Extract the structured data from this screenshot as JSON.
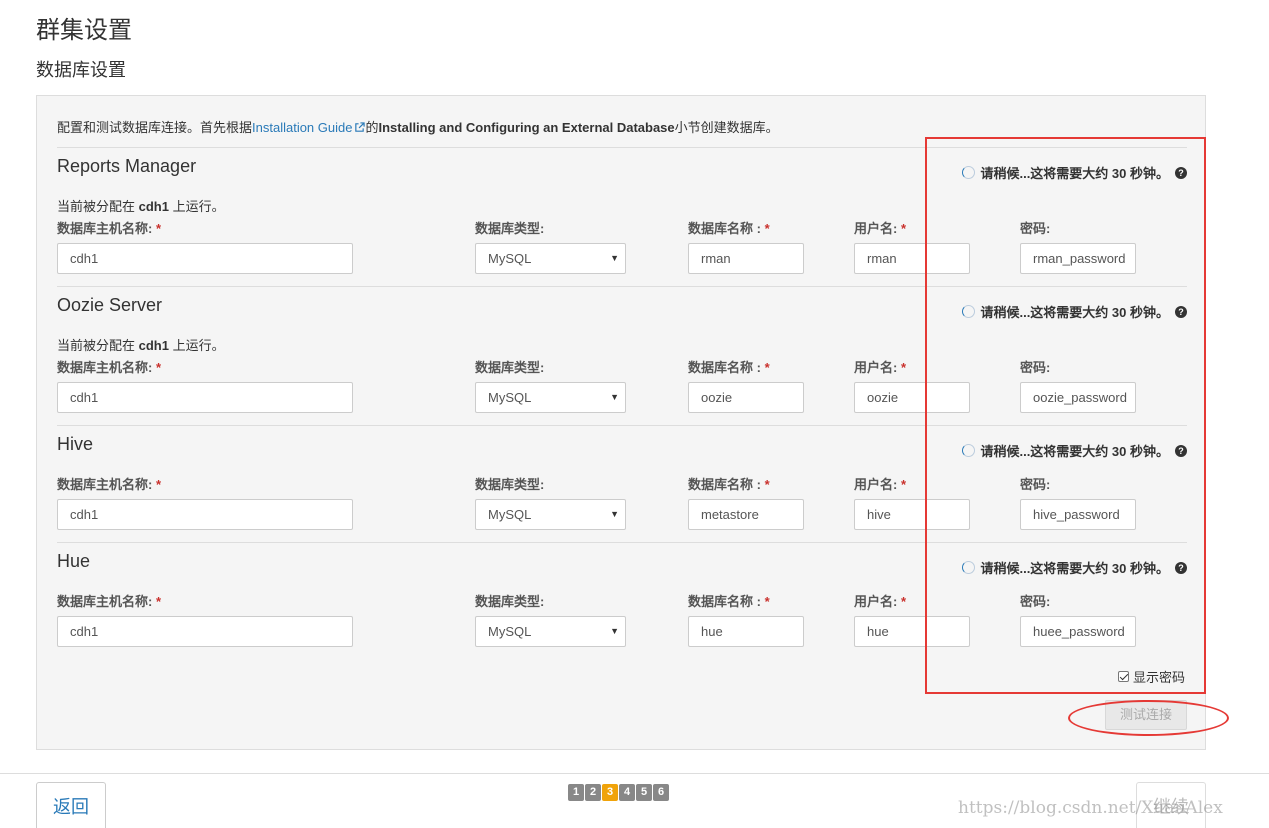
{
  "header": {
    "title": "群集设置",
    "subtitle": "数据库设置"
  },
  "intro": {
    "prefix": "配置和测试数据库连接。首先根据",
    "link": "Installation Guide",
    "middle": "的",
    "bold": "Installing and Configuring an External Database",
    "suffix": "小节创建数据库。"
  },
  "labels": {
    "host": "数据库主机名称: ",
    "type": "数据库类型:",
    "dbname": "数据库名称 : ",
    "user": "用户名: ",
    "password": "密码:",
    "required": "*"
  },
  "status_text": "请稍候...这将需要大约 30 秒钟。",
  "assigned": {
    "prefix": "当前被分配在 ",
    "host": "cdh1",
    "suffix": " 上运行。"
  },
  "sections": [
    {
      "title": "Reports Manager",
      "host": "cdh1",
      "type": "MySQL",
      "dbname": "rman",
      "user": "rman",
      "password": "rman_password"
    },
    {
      "title": "Oozie Server",
      "host": "cdh1",
      "type": "MySQL",
      "dbname": "oozie",
      "user": "oozie",
      "password": "oozie_password"
    },
    {
      "title": "Hive",
      "host": "cdh1",
      "type": "MySQL",
      "dbname": "metastore",
      "user": "hive",
      "password": "hive_password"
    },
    {
      "title": "Hue",
      "host": "cdh1",
      "type": "MySQL",
      "dbname": "hue",
      "user": "hue",
      "password": "huee_password"
    }
  ],
  "show_password": "显示密码",
  "test_button": "测试连接",
  "footer": {
    "back": "返回",
    "next": "继续",
    "steps": [
      "1",
      "2",
      "3",
      "4",
      "5",
      "6"
    ],
    "active_step": "3",
    "watermark": "https://blog.csdn.net/XuanAlex"
  }
}
